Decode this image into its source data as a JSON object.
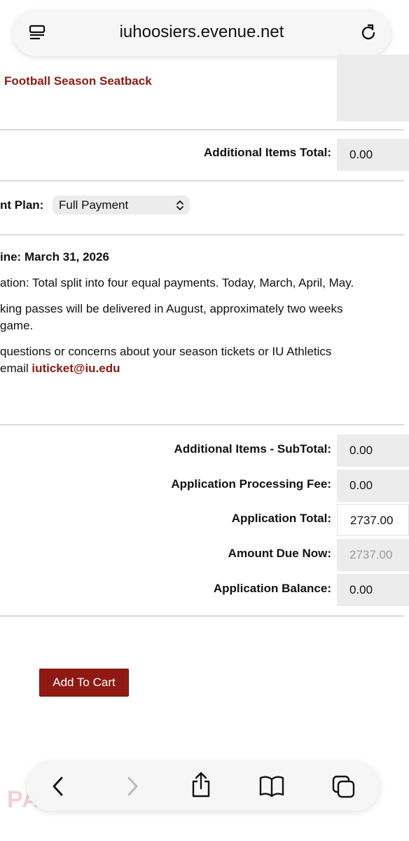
{
  "browser": {
    "url": "iuhoosiers.evenue.net"
  },
  "header": {
    "title": "Football Season Seatback"
  },
  "additional_items_total": {
    "label": "Additional Items Total:",
    "value": "0.00"
  },
  "payment_plan": {
    "label": "nt Plan:",
    "selected": "Full Payment"
  },
  "info": {
    "deadline": "ine: March 31, 2026",
    "line1": "ation: Total split into four equal payments. Today, March, April, May.",
    "line2a": "king passes will be delivered in August, approximately two weeks",
    "line2b": "game.",
    "line3a": "questions or concerns about your season tickets or IU Athletics",
    "line3b_prefix": "email ",
    "email": "iuticket@iu.edu"
  },
  "summary": [
    {
      "label": "Additional Items - SubTotal:",
      "value": "0.00"
    },
    {
      "label": "Application Processing Fee:",
      "value": "0.00"
    },
    {
      "label": "Application Total:",
      "value": "2737.00"
    },
    {
      "label": "Amount Due Now:",
      "value": "2737.00"
    },
    {
      "label": "Application Balance:",
      "value": "0.00"
    }
  ],
  "cart_button": "Add To Cart",
  "watermark": "PA",
  "colors": {
    "accent": "#8b1a14",
    "button_bg": "#8f1a13"
  }
}
